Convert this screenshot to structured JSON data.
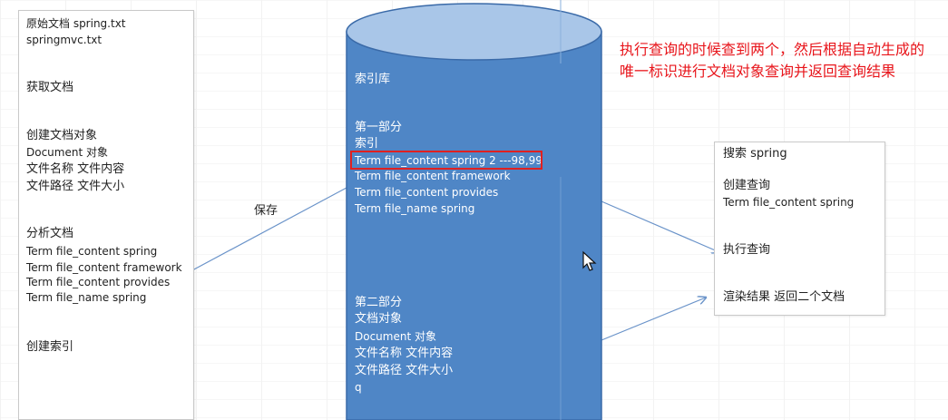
{
  "left_panel": {
    "original_doc_label": "原始文档 spring.txt",
    "original_doc_file2": "springmvc.txt",
    "get_doc": "获取文档",
    "create_doc_obj": "创建文档对象",
    "document_obj": "Document 对象",
    "file_name_content": "文件名称 文件内容",
    "file_path_size": "文件路径 文件大小",
    "analyze_doc": "分析文档",
    "terms": [
      "Term file_content spring",
      "Term file_content framework",
      "Term file_content provides",
      "Term file_name spring"
    ],
    "create_index": "创建索引"
  },
  "save_label": "保存",
  "cylinder": {
    "title": "索引库",
    "part1": "第一部分",
    "index": "索引",
    "highlighted_term": "Term file_content spring   2 ---98,99",
    "terms": [
      "Term file_content framework",
      "Term file_content provides",
      "Term file_name spring"
    ],
    "part2": "第二部分",
    "doc_obj": "文档对象",
    "document_obj": "Document 对象",
    "file_name_content": "文件名称 文件内容",
    "file_path_size": "文件路径 文件大小",
    "q": "q"
  },
  "note": "执行查询的时候查到两个，然后根据自动生成的唯一标识进行文档对象查询并返回查询结果",
  "right_panel": {
    "search": "搜索   spring",
    "create_query": "创建查询",
    "query_term": "Term   file_content spring",
    "execute_query": "执行查询",
    "render_results": "渲染结果    返回二个文档"
  },
  "colors": {
    "cylinder_body": "#4f86c6",
    "cylinder_top": "#a9c6e8",
    "note_red": "#e8151b",
    "highlight_border": "#e02020"
  }
}
